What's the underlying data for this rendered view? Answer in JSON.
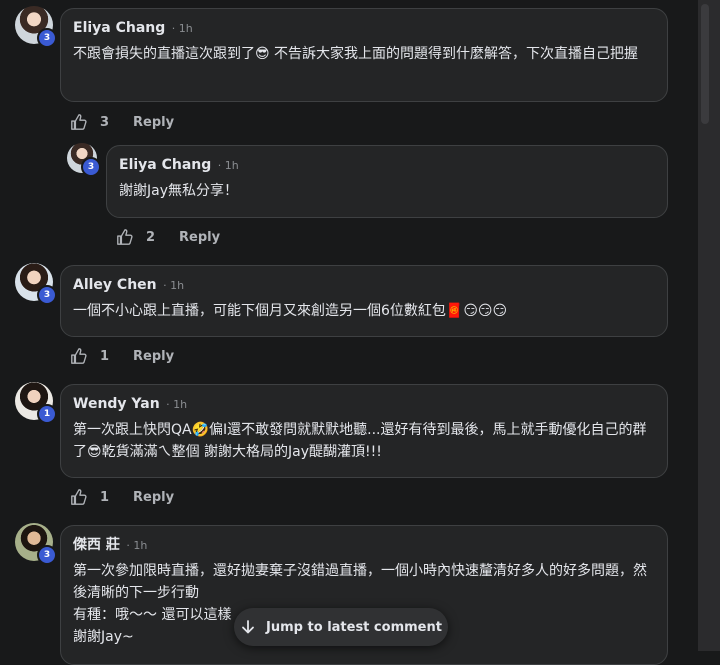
{
  "comments": [
    {
      "author": "Eliya Chang",
      "time": "· 1h",
      "badge": "3",
      "text": "不跟會損失的直播這次跟到了😎 不告訴大家我上面的問題得到什麼解答，下次直播自己把握",
      "likes": "3",
      "reply_label": "Reply"
    },
    {
      "author": "Eliya Chang",
      "time": "· 1h",
      "badge": "3",
      "text": "謝謝Jay無私分享！",
      "likes": "2",
      "reply_label": "Reply"
    },
    {
      "author": "Alley Chen",
      "time": "· 1h",
      "badge": "3",
      "text": "一個不小心跟上直播，可能下個月又來創造另一個6位數紅包🧧😏😏😏",
      "likes": "1",
      "reply_label": "Reply"
    },
    {
      "author": "Wendy Yan",
      "time": "· 1h",
      "badge": "1",
      "text": "第一次跟上快閃QA🤣偏I還不敢發問就默默地聽...還好有待到最後，馬上就手動優化自己的群了😎乾貨滿滿ㄟ整個 謝謝大格局的Jay醍醐灌頂!!!",
      "likes": "1",
      "reply_label": "Reply"
    },
    {
      "author": "傑西 莊",
      "time": "· 1h",
      "badge": "3",
      "text": "第一次參加限時直播，還好拋妻棄子沒錯過直播，一個小時內快速釐清好多人的好多問題，然後清晰的下一步行動\n有種：哦～～ 還可以這樣\n謝謝Jay~"
    }
  ],
  "jump_button": {
    "label": "Jump to latest comment",
    "icon": "arrow-down-icon"
  },
  "colors": {
    "background": "#18191a",
    "bubble": "#242526",
    "bubble_border": "#3e4042",
    "badge": "#3a5ad3",
    "muted_text": "#b0b3b8"
  }
}
